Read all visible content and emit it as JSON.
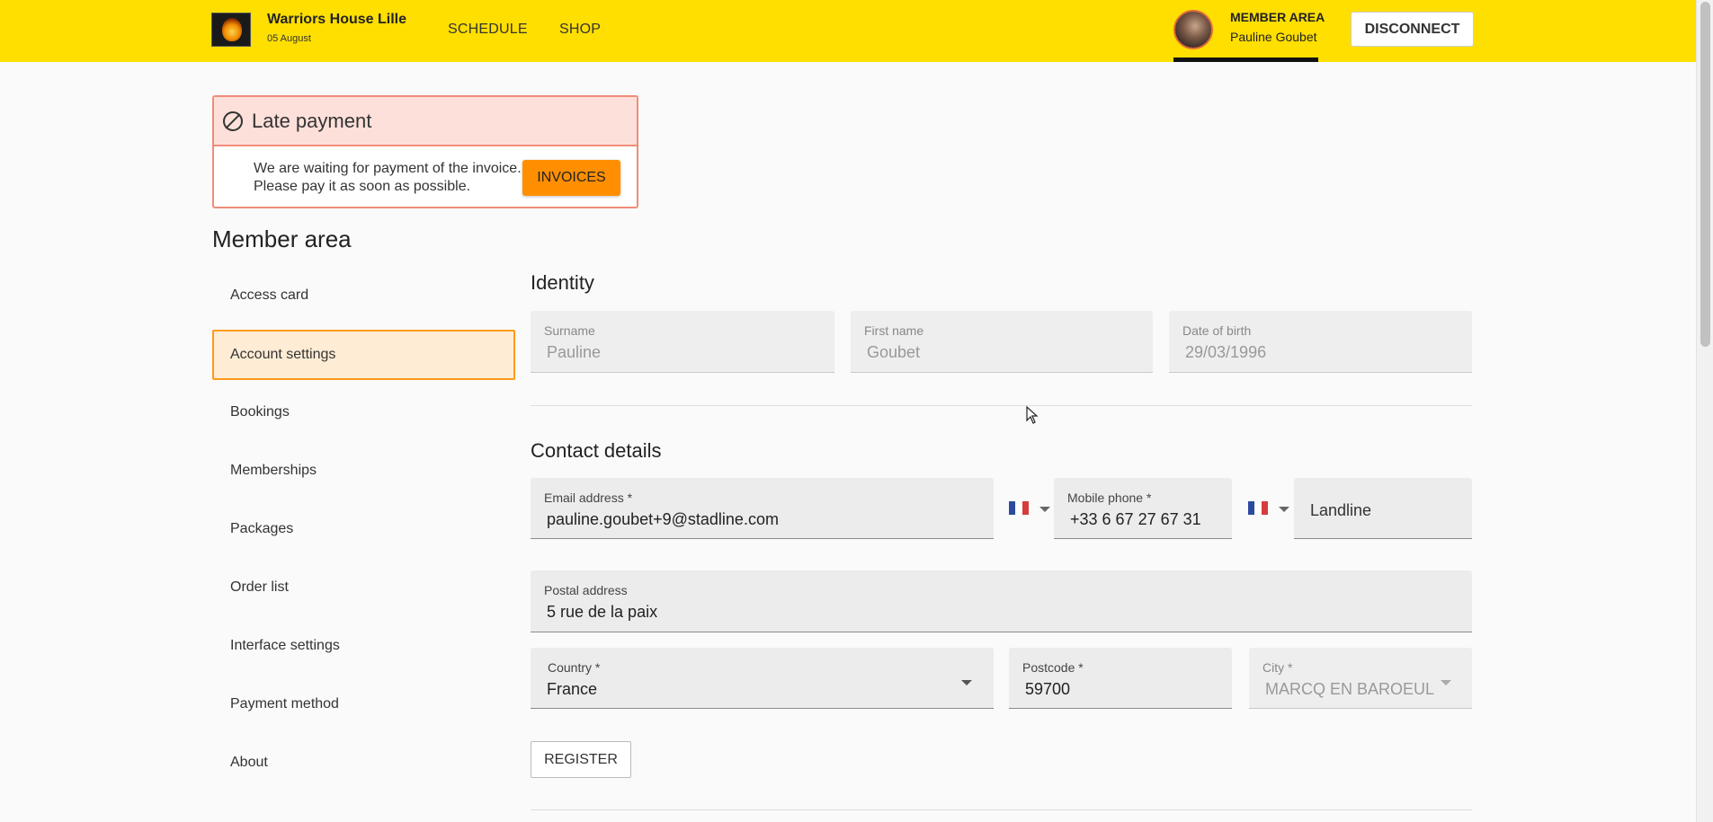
{
  "header": {
    "site_name": "Warriors House Lille",
    "date": "05 August",
    "nav": {
      "schedule": "SCHEDULE",
      "shop": "SHOP"
    },
    "member_area_label": "MEMBER AREA",
    "member_name": "Pauline Goubet",
    "disconnect_label": "DISCONNECT"
  },
  "alert": {
    "title": "Late payment",
    "line1": "We are waiting for payment of the invoice.",
    "line2": "Please pay it as soon as possible.",
    "button_label": "INVOICES"
  },
  "page_title": "Member area",
  "sidebar": {
    "items": [
      {
        "label": "Access card"
      },
      {
        "label": "Account settings",
        "active": true
      },
      {
        "label": "Bookings"
      },
      {
        "label": "Memberships"
      },
      {
        "label": "Packages"
      },
      {
        "label": "Order list"
      },
      {
        "label": "Interface settings"
      },
      {
        "label": "Payment method"
      },
      {
        "label": "About"
      }
    ]
  },
  "identity": {
    "title": "Identity",
    "surname": {
      "label": "Surname",
      "value": "Pauline"
    },
    "first_name": {
      "label": "First name",
      "value": "Goubet"
    },
    "dob": {
      "label": "Date of birth",
      "value": "29/03/1996"
    }
  },
  "contact": {
    "title": "Contact details",
    "email": {
      "label": "Email address *",
      "value": "pauline.goubet+9@stadline.com"
    },
    "mobile": {
      "label": "Mobile phone *",
      "value": "+33 6 67 27 67 31"
    },
    "landline": {
      "placeholder": "Landline"
    },
    "postal": {
      "label": "Postal address",
      "value": "5 rue de la paix"
    },
    "country": {
      "label": "Country *",
      "value": "France"
    },
    "postcode": {
      "label": "Postcode *",
      "value": "59700"
    },
    "city": {
      "label": "City *",
      "value": "MARCQ EN BAROEUL"
    }
  },
  "register_label": "REGISTER",
  "icons": {
    "ban": "ban-icon",
    "flag": "flag-fr-icon",
    "dropdown": "chevron-down-icon"
  },
  "colors": {
    "header_bg": "#ffdf00",
    "alert_border": "#f08c78",
    "alert_bg": "#fde0da",
    "invoices_btn": "#ff8f00",
    "active_sidebar_bg": "#feecd5",
    "active_sidebar_border": "#ff9b17"
  }
}
